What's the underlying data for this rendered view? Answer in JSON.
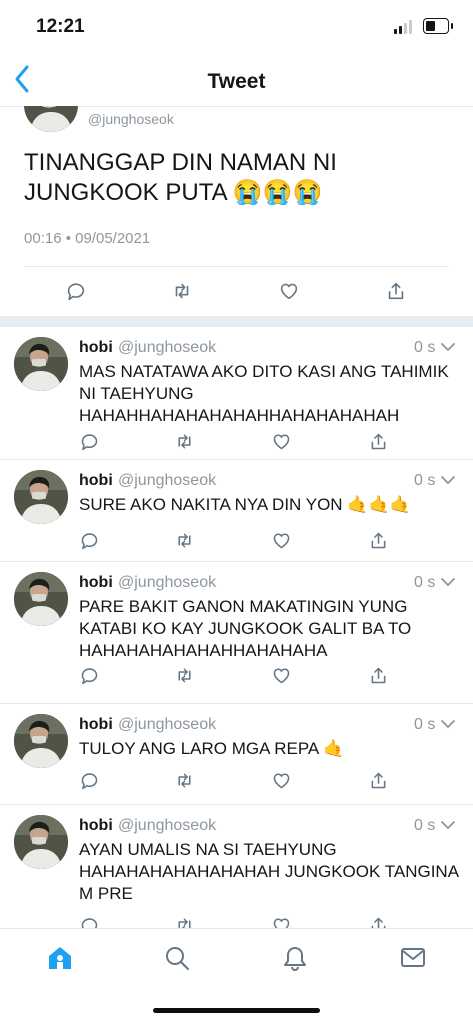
{
  "status_bar": {
    "time": "12:21"
  },
  "nav": {
    "title": "Tweet"
  },
  "main_tweet": {
    "handle": "@junghoseok",
    "text": "TINANGGAP DIN NAMAN NI JUNGKOOK PUTA 😭😭😭",
    "date": "00:16 • 09/05/2021"
  },
  "replies": [
    {
      "name": "hobi",
      "handle": "@junghoseok",
      "time": "0 s",
      "text": "MAS NATATAWA AKO DITO KASI ANG TAHIMIK NI TAEHYUNG HAHAHHAHAHAHAHAHHAHAHAHAHAH"
    },
    {
      "name": "hobi",
      "handle": "@junghoseok",
      "time": "0 s",
      "text": "SURE AKO NAKITA NYA DIN YON 🤙🤙🤙"
    },
    {
      "name": "hobi",
      "handle": "@junghoseok",
      "time": "0 s",
      "text": "PARE BAKIT GANON MAKATINGIN YUNG KATABI KO KAY JUNGKOOK GALIT BA TO HAHAHAHAHAHAHHAHAHAHA"
    },
    {
      "name": "hobi",
      "handle": "@junghoseok",
      "time": "0 s",
      "text": "TULOY ANG LARO MGA REPA 🤙"
    },
    {
      "name": "hobi",
      "handle": "@junghoseok",
      "time": "0 s",
      "text": "AYAN UMALIS NA SI TAEHYUNG HAHAHAHAHAHAHAHAH JUNGKOOK TANGINA M PRE"
    }
  ],
  "icons": {
    "reply": "reply-icon",
    "retweet": "retweet-icon",
    "like": "like-icon",
    "share": "share-icon",
    "back": "back-chevron-icon",
    "tabs": [
      "home-icon",
      "search-icon",
      "notifications-icon",
      "messages-icon"
    ]
  },
  "colors": {
    "accent": "#1da1f2",
    "secondary_text": "#8d979f",
    "divider": "#e1e8ed"
  }
}
